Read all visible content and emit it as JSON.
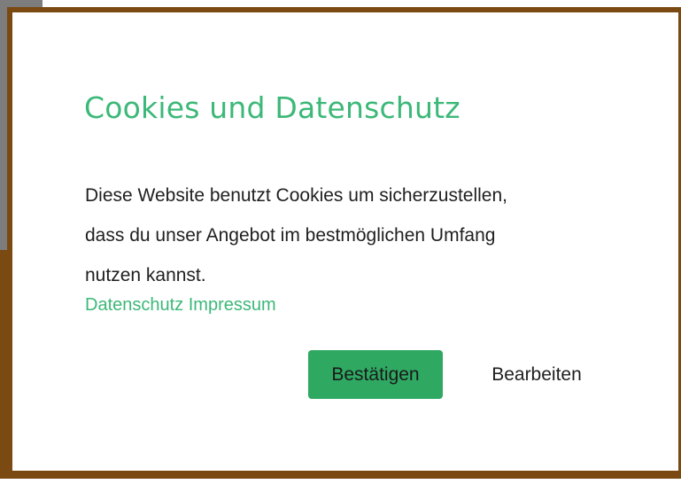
{
  "dialog": {
    "title": "Cookies und Datenschutz",
    "body_lines": [
      "Diese Website benutzt Cookies um sicherzustellen,",
      "dass du unser Angebot im bestmöglichen Umfang",
      "nutzen kannst."
    ],
    "links": {
      "privacy": "Datenschutz",
      "imprint": "Impressum"
    },
    "buttons": {
      "confirm": "Bestätigen",
      "edit": "Bearbeiten"
    }
  },
  "colors": {
    "accent": "#3cb878",
    "confirm_button": "#2fa862",
    "backdrop": "#7a4a12"
  }
}
